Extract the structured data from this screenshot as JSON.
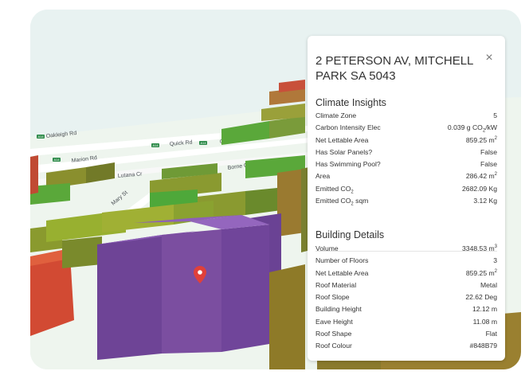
{
  "map": {
    "road_labels": {
      "oakleigh": "Oakleigh Rd",
      "marion": "Marion Rd",
      "quick1": "Quick Rd",
      "quick2": "Quick Rd",
      "lutana": "Lutana Cr",
      "mary": "Mary St",
      "borne": "Borne Cr"
    },
    "shields": [
      "A14",
      "A14",
      "A14",
      "A14"
    ],
    "colors": {
      "selected_building": "#7b4ea0",
      "ground": "#e8f2f1",
      "green_building": "#5aa83a",
      "olive_building": "#8a8f2e",
      "red_building": "#d24a33"
    }
  },
  "panel": {
    "title": "2 PETERSON AV, MITCHELL PARK SA 5043",
    "close_label": "×",
    "climate": {
      "heading": "Climate Insights",
      "rows": [
        {
          "label": "Climate Zone",
          "value": "5"
        },
        {
          "label": "Carbon Intensity Elec",
          "value_pre": "0.039 g CO",
          "value_sub": "2",
          "value_post": "/kW"
        },
        {
          "label": "Net Lettable Area",
          "value_pre": "859.25 m",
          "value_sup": "2"
        },
        {
          "label": "Has Solar Panels?",
          "value": "False"
        },
        {
          "label": "Has Swimming Pool?",
          "value": "False"
        },
        {
          "label": "Area",
          "value_pre": "286.42 m",
          "value_sup": "2"
        },
        {
          "label_pre": "Emitted CO",
          "label_sub": "2",
          "value": "2682.09 Kg"
        },
        {
          "label_pre": "Emitted CO",
          "label_sub": "2",
          "label_post": " sqm",
          "value": "3.12 Kg"
        }
      ]
    },
    "building": {
      "heading": "Building Details",
      "rows": [
        {
          "label": "Volume",
          "value_pre": "3348.53 m",
          "value_sup": "3"
        },
        {
          "label": "Number of Floors",
          "value": "3"
        },
        {
          "label": "Net Lettable Area",
          "value_pre": "859.25 m",
          "value_sup": "2"
        },
        {
          "label": "Roof Material",
          "value": "Metal"
        },
        {
          "label": "Roof Slope",
          "value": "22.62 Deg"
        },
        {
          "label": "Building Height",
          "value": "12.12 m"
        },
        {
          "label": "Eave Height",
          "value": "11.08 m"
        },
        {
          "label": "Roof Shape",
          "value": "Flat"
        },
        {
          "label": "Roof Colour",
          "value": "#848B79"
        }
      ]
    }
  }
}
